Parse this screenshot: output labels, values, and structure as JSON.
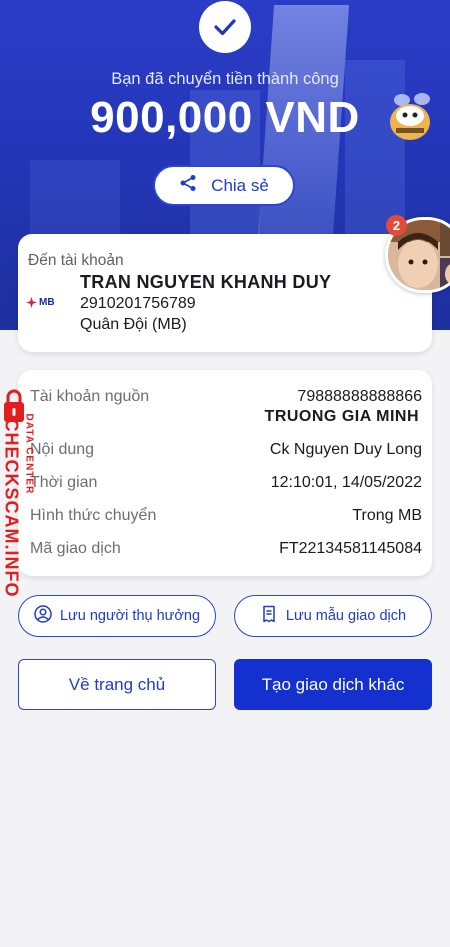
{
  "header": {
    "subtitle": "Bạn đã chuyển tiền thành công",
    "amount": "900,000 VND",
    "share_label": "Chia sẻ"
  },
  "destination": {
    "label": "Đến tài khoản",
    "bank_logo_text": "MB",
    "name": "TRAN NGUYEN KHANH DUY",
    "account": "2910201756789",
    "bank": "Quân Đội (MB)"
  },
  "chat_bubble": {
    "badge_count": "2"
  },
  "details": {
    "source_label": "Tài khoản nguồn",
    "source_account": "79888888888866",
    "source_name": "TRUONG GIA MINH",
    "content_label": "Nội dung",
    "content_value": "Ck Nguyen Duy Long",
    "time_label": "Thời gian",
    "time_value": "12:10:01, 14/05/2022",
    "method_label": "Hình thức chuyển",
    "method_value": "Trong MB",
    "txid_label": "Mã giao dịch",
    "txid_value": "FT22134581145084"
  },
  "watermark": {
    "text": "CHECKSCAM.INFO",
    "sub": "DATA CENTER"
  },
  "actions": {
    "save_payee": "Lưu người thụ hưởng",
    "save_template": "Lưu mẫu giao dịch",
    "home": "Về trang chủ",
    "new_transaction": "Tạo giao dịch khác"
  },
  "colors": {
    "primary": "#1431d0",
    "header_bg": "#2436b8",
    "watermark": "#e11d1d",
    "badge": "#e24a3b"
  }
}
